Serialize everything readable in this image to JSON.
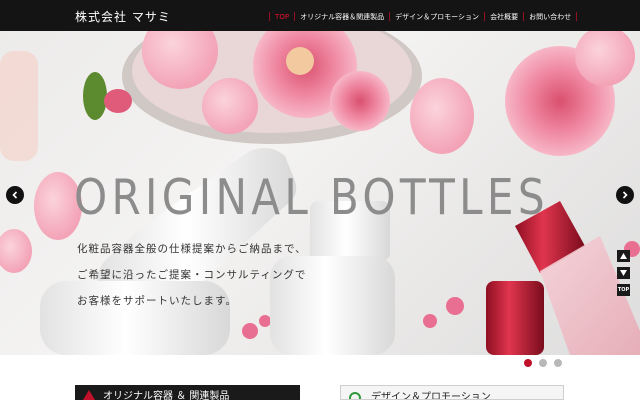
{
  "header": {
    "logo": "株式会社 マサミ",
    "nav": [
      {
        "label": "TOP",
        "active": true
      },
      {
        "label": "オリジナル容器＆関連製品",
        "active": false
      },
      {
        "label": "デザイン＆プロモーション",
        "active": false
      },
      {
        "label": "会社概要",
        "active": false
      },
      {
        "label": "お問い合わせ",
        "active": false
      }
    ],
    "separator": "|"
  },
  "hero": {
    "title": "ORIGINAL BOTTLES",
    "copy": [
      "化粧品容器全般の仕様提案からご納品まで、",
      "ご希望に沿ったご提案・コンサルティングで",
      "お客様をサポートいたします。"
    ],
    "prev_icon": "chevron-left-icon",
    "next_icon": "chevron-right-icon",
    "slides": 3,
    "active_slide": 1
  },
  "side_controls": {
    "up_icon": "triangle-up-icon",
    "down_icon": "triangle-down-icon",
    "top_label": "TOP"
  },
  "banners": {
    "left_label": "オリジナル容器 ＆ 関連製品",
    "right_label": "デザイン＆プロモーション"
  },
  "colors": {
    "header_bg": "#141414",
    "accent": "#c0102a",
    "nav_text": "#ffffff",
    "title_gray": "#8c8c8c"
  }
}
